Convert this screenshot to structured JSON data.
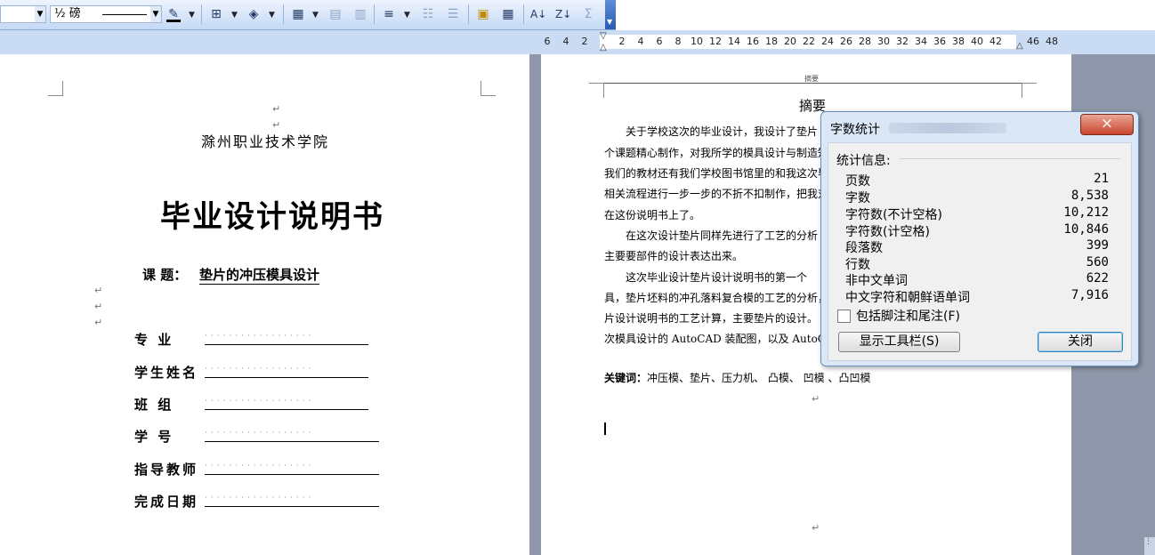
{
  "toolbar": {
    "line_weight": "½ 磅",
    "sigma": "Σ"
  },
  "ruler": {
    "ticks": [
      "6",
      "4",
      "2",
      "2",
      "4",
      "6",
      "8",
      "10",
      "12",
      "14",
      "16",
      "18",
      "20",
      "22",
      "24",
      "26",
      "28",
      "30",
      "32",
      "34",
      "36",
      "38",
      "40",
      "42",
      "46",
      "48"
    ]
  },
  "cover": {
    "school": "滁州职业技术学院",
    "title": "毕业设计说明书",
    "topic_label": "课 题：",
    "topic_value": "垫片的冲压模具设计",
    "fields": [
      "专 业",
      "学生姓名",
      "班 组",
      "学 号",
      "指导教师",
      "完成日期"
    ]
  },
  "abstract_page": {
    "header_mark": "摘要",
    "heading": "摘要",
    "lines": [
      "关于学校这次的毕业设计，我设计了垫片",
      "个课题精心制作，对我所学的模具设计与制造知",
      "我们的教材还有我们学校图书馆里的和我这次毕",
      "相关流程进行一步一步的不折不扣制作，把我对",
      "在这份说明书上了。",
      "在这次设计垫片同样先进行了工艺的分析",
      "主要要部件的设计表达出来。",
      "这次毕业设计垫片设计说明书的第一个",
      "具，垫片坯料的冲孔落料复合模的工艺的分析，",
      "片设计说明书的工艺计算，主要垫片的设计。",
      "次模具设计的 AutoCAD 装配图，以及 AutoCAD"
    ],
    "keywords_label": "关键词：",
    "keywords": "冲压模、垫片、压力机、 凸模、 凹模 、凸凹模"
  },
  "dialog": {
    "title": "字数统计",
    "close_x": "×",
    "section_label": "统计信息:",
    "stats": [
      {
        "name": "页数",
        "value": "21"
      },
      {
        "name": "字数",
        "value": "8,538"
      },
      {
        "name": "字符数(不计空格)",
        "value": "10,212"
      },
      {
        "name": "字符数(计空格)",
        "value": "10,846"
      },
      {
        "name": "段落数",
        "value": "399"
      },
      {
        "name": "行数",
        "value": "560"
      },
      {
        "name": "非中文单词",
        "value": "622"
      },
      {
        "name": "中文字符和朝鲜语单词",
        "value": "7,916"
      }
    ],
    "checkbox_label": "包括脚注和尾注(F)",
    "show_toolbar_button": "显示工具栏(S)",
    "close_button": "关闭"
  },
  "colors": {
    "toolbar": "#c4d9f5",
    "dialog_close": "#c9462c"
  }
}
